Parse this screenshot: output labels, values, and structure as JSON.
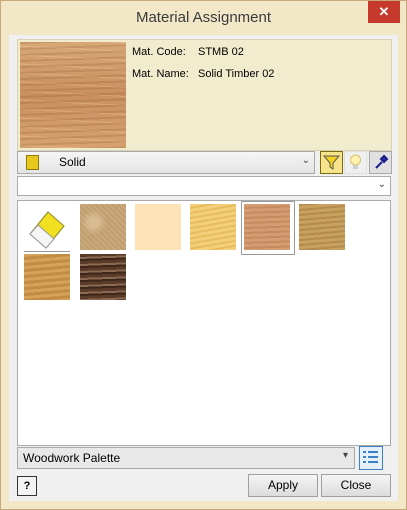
{
  "window": {
    "title": "Material Assignment",
    "close_glyph": "✕"
  },
  "material": {
    "code_label": "Mat. Code:",
    "code": "STMB 02",
    "name_label": "Mat. Name:",
    "name": "Solid Timber 02"
  },
  "type_combo": {
    "value": "Solid",
    "icon": "solid-material-icon"
  },
  "toolbar": {
    "filter_icon": "filter-icon",
    "bulb_icon": "lightbulb-icon",
    "picker_icon": "eyedropper-icon"
  },
  "search": {
    "value": ""
  },
  "palette": {
    "eraser_icon": "eraser-icon",
    "selected_index": 4,
    "swatches": [
      {
        "name": "swatch-sand",
        "color": "#c9a87a"
      },
      {
        "name": "swatch-cream",
        "color": "#fde2b6"
      },
      {
        "name": "swatch-light-pine",
        "color": "#f3cf7a"
      },
      {
        "name": "swatch-solid-timber-02",
        "color": "#d49c72"
      },
      {
        "name": "swatch-oak",
        "color": "#b48a4e"
      },
      {
        "name": "swatch-birch",
        "color": "#d6a25a"
      },
      {
        "name": "swatch-walnut",
        "color": "#5a3a28"
      }
    ]
  },
  "palette_select": {
    "value": "Woodwork Palette"
  },
  "buttons": {
    "help": "?",
    "apply": "Apply",
    "close": "Close"
  },
  "colors": {
    "title_bg": "#f2e8c8",
    "close_red": "#c7392d",
    "info_bg": "#f2eccf"
  }
}
